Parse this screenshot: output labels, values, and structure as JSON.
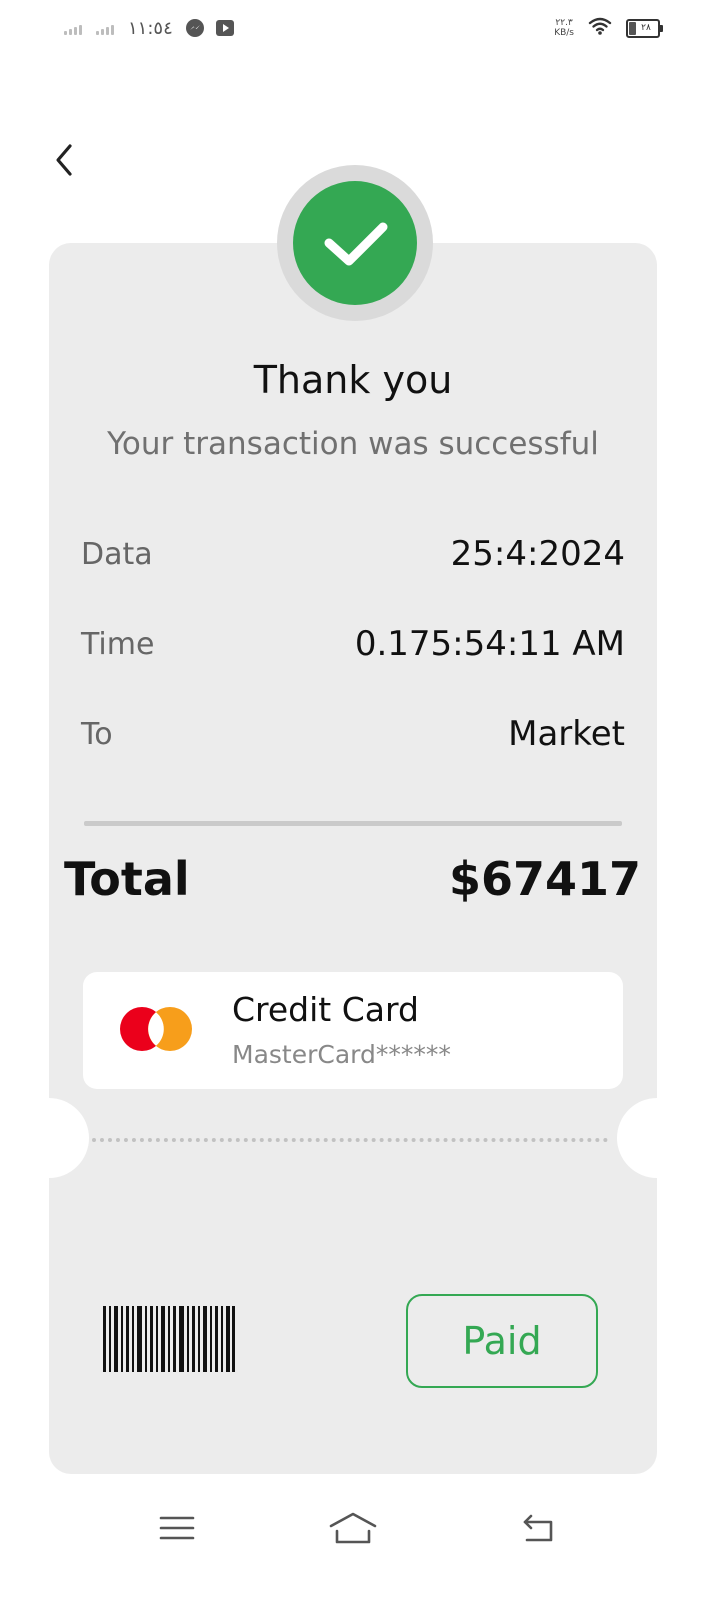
{
  "status_bar": {
    "time": "١١:٥٤",
    "net_speed_value": "٢٢.٣",
    "net_speed_unit": "KB/s",
    "battery": "٢٨",
    "app_icons": [
      "messenger-icon",
      "youtube-icon"
    ]
  },
  "header": {
    "back_icon": "chevron-left-icon"
  },
  "receipt": {
    "status_icon": "checkmark-icon",
    "title": "Thank you",
    "subtitle": "Your transaction was successful",
    "details": [
      {
        "label": "Data",
        "value": "25:4:2024"
      },
      {
        "label": "Time",
        "value": "0.175:54:11 AM"
      },
      {
        "label": "To",
        "value": "Market"
      }
    ],
    "total_label": "Total",
    "total_value": "$67417",
    "payment_method": {
      "title": "Credit Card",
      "subtitle": "MasterCard******",
      "logo": "mastercard-logo"
    },
    "paid_label": "Paid"
  },
  "nav_bar": {
    "icons": [
      "menu-icon",
      "home-icon",
      "back-icon"
    ]
  },
  "colors": {
    "accent_green": "#34a853",
    "card_background": "#ececec",
    "mastercard_red": "#eb001b",
    "mastercard_orange": "#f79e1b"
  }
}
